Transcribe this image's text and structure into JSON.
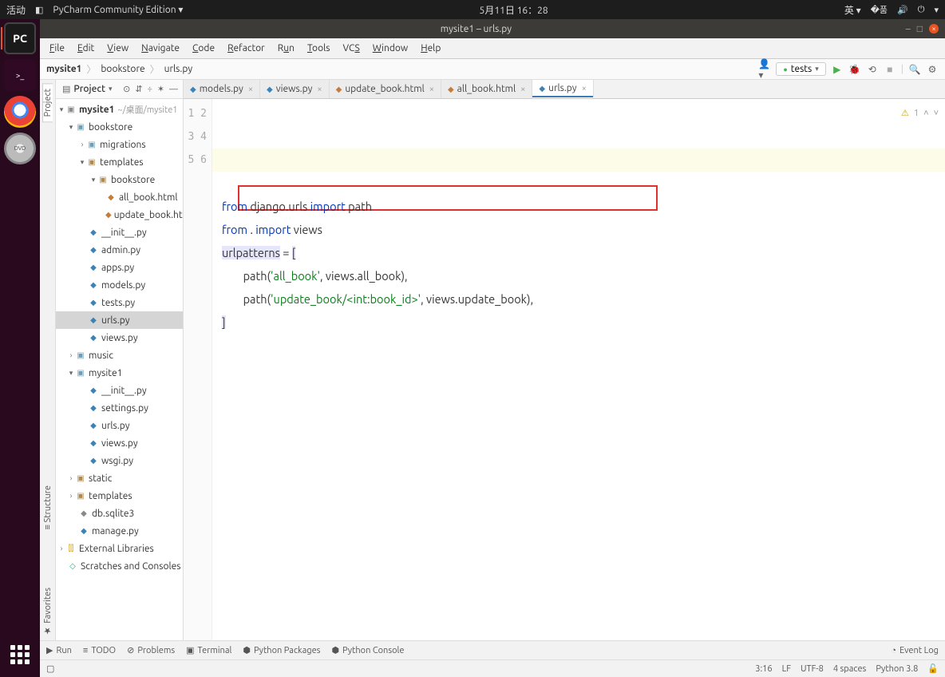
{
  "topbar": {
    "activities": "活动",
    "app_name": "PyCharm Community Edition",
    "datetime": "5月11日 16：28",
    "input_method": "英"
  },
  "window": {
    "title": "mysite1 – urls.py"
  },
  "menu": {
    "file": "File",
    "edit": "Edit",
    "view": "View",
    "navigate": "Navigate",
    "code": "Code",
    "refactor": "Refactor",
    "run": "Run",
    "tools": "Tools",
    "vcs": "VCS",
    "window": "Window",
    "help": "Help"
  },
  "breadcrumb": {
    "p1": "mysite1",
    "p2": "bookstore",
    "p3": "urls.py"
  },
  "run_config": {
    "label": "tests"
  },
  "project_panel": {
    "title": "Project"
  },
  "tree": {
    "root_name": "mysite1",
    "root_note": "~/桌面/mysite1",
    "bookstore": "bookstore",
    "migrations": "migrations",
    "templates": "templates",
    "bookstore_tpl": "bookstore",
    "all_book_html": "all_book.html",
    "update_book_html": "update_book.html",
    "init_py": "__init__.py",
    "admin_py": "admin.py",
    "apps_py": "apps.py",
    "models_py": "models.py",
    "tests_py": "tests.py",
    "urls_py": "urls.py",
    "views_py": "views.py",
    "music": "music",
    "mysite1_pkg": "mysite1",
    "settings_py": "settings.py",
    "wsgi_py": "wsgi.py",
    "static": "static",
    "templates_root": "templates",
    "db_sqlite3": "db.sqlite3",
    "manage_py": "manage.py",
    "ext_libs": "External Libraries",
    "scratches": "Scratches and Consoles"
  },
  "sidetabs": {
    "project": "Project",
    "structure": "Structure",
    "favorites": "Favorites"
  },
  "editor_tabs": {
    "models": "models.py",
    "views": "views.py",
    "update_book": "update_book.html",
    "all_book": "all_book.html",
    "urls": "urls.py"
  },
  "code": {
    "l1_from": "from",
    "l1_mod": "django.urls",
    "l1_import": "import",
    "l1_name": "path",
    "l2_from": "from",
    "l2_dot": ".",
    "l2_import": "import",
    "l2_name": "views",
    "l3_var": "urlpatterns",
    "l3_eq": " = ",
    "l3_brk": "[",
    "l4_pre": "        path(",
    "l4_str": "'all_book'",
    "l4_mid": ", views.all_book),",
    "l5_pre": "        path(",
    "l5_str": "'update_book/<int:book_id>'",
    "l5_mid": ", views.update_book),",
    "l6_brk": "]"
  },
  "indicators": {
    "warn_count": "1"
  },
  "bottombar": {
    "run": "Run",
    "todo": "TODO",
    "problems": "Problems",
    "terminal": "Terminal",
    "python_packages": "Python Packages",
    "python_console": "Python Console",
    "event_log": "Event Log"
  },
  "status": {
    "pos": "3:16",
    "line_sep": "LF",
    "encoding": "UTF-8",
    "indent": "4 spaces",
    "python": "Python 3.8"
  }
}
